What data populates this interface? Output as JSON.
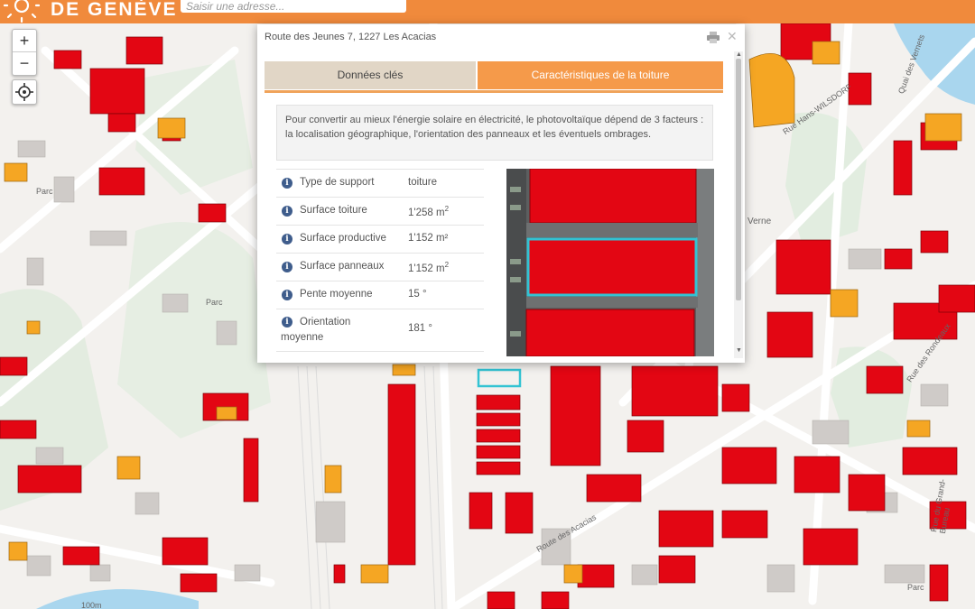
{
  "header": {
    "logo_text": "DE GENÈVE",
    "search_placeholder": "Saisir une adresse..."
  },
  "map_controls": {
    "zoom_in": "+",
    "zoom_out": "−"
  },
  "map_labels": {
    "parc_1": "Parc",
    "parc_2": "Parc",
    "parc_3": "Parc",
    "street_acacias": "Route des Acacias",
    "street_vernets": "Quai des Vernets",
    "street_wilsdorf": "Rue Hans-WILSDORF",
    "street_rondeau": "Rue des Rondeaux",
    "street_grand_bureau": "Rue du Grand-Bureau",
    "verne": "Verne",
    "scale": "100m"
  },
  "popup": {
    "address": "Route des Jeunes 7, 1227 Les Acacias",
    "tabs": [
      {
        "label": "Données clés",
        "active": false
      },
      {
        "label": "Caractéristiques de la toiture",
        "active": true
      }
    ],
    "intro": "Pour convertir au mieux l'énergie solaire en électricité, le photovoltaïque dépend de 3 facteurs : la localisation géographique, l'orientation des panneaux et les éventuels ombrages.",
    "attributes": [
      {
        "label": "Type de support",
        "value": "toiture",
        "unit": ""
      },
      {
        "label": "Surface toiture",
        "value": "1'258 m",
        "unit": "2"
      },
      {
        "label": "Surface productive",
        "value": "1'152 m²",
        "unit": ""
      },
      {
        "label": "Surface panneaux",
        "value": "1'152 m",
        "unit": "2"
      },
      {
        "label": "Pente moyenne",
        "value": "15 °",
        "unit": ""
      },
      {
        "label": "Orientation moyenne",
        "value": "181 °",
        "unit": ""
      }
    ]
  },
  "colors": {
    "header_orange": "#f08a3c",
    "roof_red": "#e30613",
    "roof_orange": "#f5a623",
    "selected_outline": "#33c3d3",
    "tab_active": "#f59a4a",
    "tab_inactive": "#e1d6c6"
  }
}
